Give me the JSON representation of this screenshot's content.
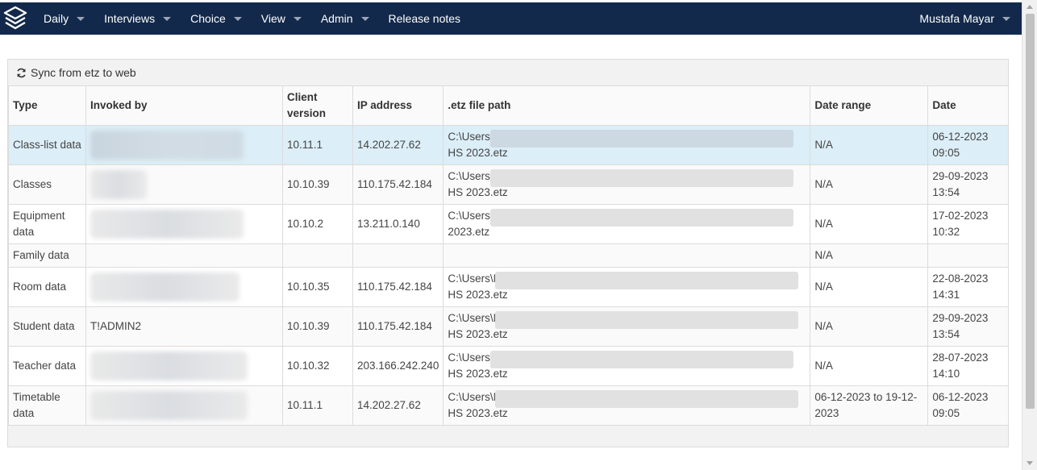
{
  "nav": {
    "items": [
      {
        "label": "Daily",
        "dropdown": true
      },
      {
        "label": "Interviews",
        "dropdown": true
      },
      {
        "label": "Choice",
        "dropdown": true
      },
      {
        "label": "View",
        "dropdown": true
      },
      {
        "label": "Admin",
        "dropdown": true
      },
      {
        "label": "Release notes",
        "dropdown": false
      }
    ],
    "user": "Mustafa Mayar"
  },
  "toolbar": {
    "sync_label": "Sync from etz to web",
    "sync_icon": "refresh-icon"
  },
  "table": {
    "headers": {
      "type": "Type",
      "invoked_by": "Invoked by",
      "client_version": "Client version",
      "ip_address": "IP address",
      "path": ".etz file path",
      "date_range": "Date range",
      "date": "Date"
    },
    "rows": [
      {
        "type": "Class-list data",
        "invoked_by": "",
        "client_version": "10.11.1",
        "ip": "14.202.27.62",
        "path_start": "C:\\Users\\",
        "path_end": "HS 2023.etz",
        "date_range": "N/A",
        "date": "06-12-2023",
        "time": "09:05"
      },
      {
        "type": "Classes",
        "invoked_by": "",
        "client_version": "10.10.39",
        "ip": "110.175.42.184",
        "path_start": "C:\\Users\\",
        "path_end": "HS 2023.etz",
        "date_range": "N/A",
        "date": "29-09-2023",
        "time": "13:54"
      },
      {
        "type": "Equipment data",
        "invoked_by": "",
        "client_version": "10.10.2",
        "ip": "13.211.0.140",
        "path_start": "C:\\Users\\",
        "path_end": "2023.etz",
        "date_range": "N/A",
        "date": "17-02-2023",
        "time": "10:32"
      },
      {
        "type": "Family data",
        "invoked_by": "",
        "client_version": "",
        "ip": "",
        "path_start": "",
        "path_end": "",
        "date_range": "N/A",
        "date": "",
        "time": ""
      },
      {
        "type": "Room data",
        "invoked_by": "",
        "client_version": "10.10.35",
        "ip": "110.175.42.184",
        "path_start": "C:\\Users\\N",
        "path_end": "HS 2023.etz",
        "date_range": "N/A",
        "date": "22-08-2023",
        "time": "14:31"
      },
      {
        "type": "Student data",
        "invoked_by": "T!ADMIN2",
        "client_version": "10.10.39",
        "ip": "110.175.42.184",
        "path_start": "C:\\Users\\N",
        "path_end": "HS 2023.etz",
        "date_range": "N/A",
        "date": "29-09-2023",
        "time": "13:54"
      },
      {
        "type": "Teacher data",
        "invoked_by": "",
        "client_version": "10.10.32",
        "ip": "203.166.242.240",
        "path_start": "C:\\Users\\",
        "path_end": "HS 2023.etz",
        "date_range": "N/A",
        "date": "28-07-2023",
        "time": "14:10"
      },
      {
        "type": "Timetable data",
        "invoked_by": "",
        "client_version": "10.11.1",
        "ip": "14.202.27.62",
        "path_start": "C:\\Users\\N",
        "path_end": "HS 2023.etz",
        "date_range": "06-12-2023 to 19-12-2023",
        "date": "06-12-2023",
        "time": "09:05"
      }
    ]
  },
  "colors": {
    "navbar": "#12294b",
    "selected_row": "#dceef7"
  }
}
